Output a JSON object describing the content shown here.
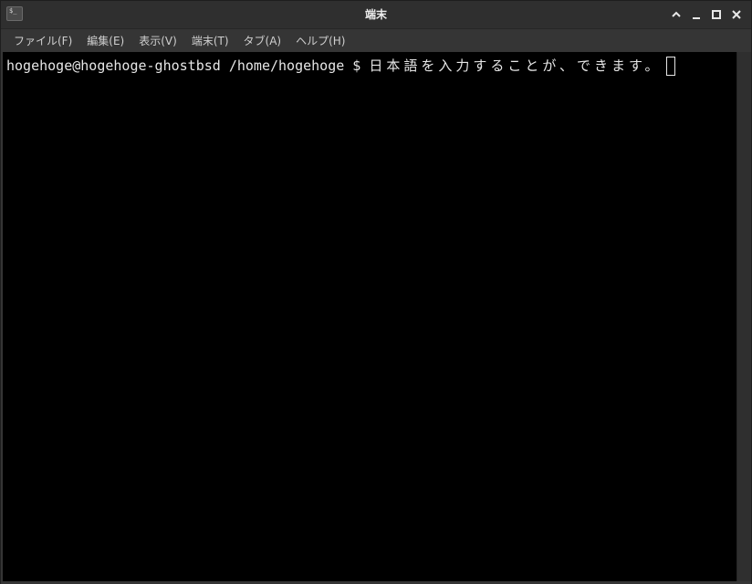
{
  "window": {
    "title": "端末",
    "app_icon_text": "$_"
  },
  "menubar": {
    "items": [
      {
        "label": "ファイル(F)"
      },
      {
        "label": "編集(E)"
      },
      {
        "label": "表示(V)"
      },
      {
        "label": "端末(T)"
      },
      {
        "label": "タブ(A)"
      },
      {
        "label": "ヘルプ(H)"
      }
    ]
  },
  "terminal": {
    "prompt": "hogehoge@hogehoge-ghostbsd /home/hogehoge $ ",
    "input": "日本語を入力することが、できます。",
    "background": "#000000",
    "foreground": "#e6e6e6"
  },
  "icons": {
    "minimize": "chevron-up-icon",
    "iconify": "minimize-icon",
    "maximize": "maximize-icon",
    "close": "close-icon"
  }
}
